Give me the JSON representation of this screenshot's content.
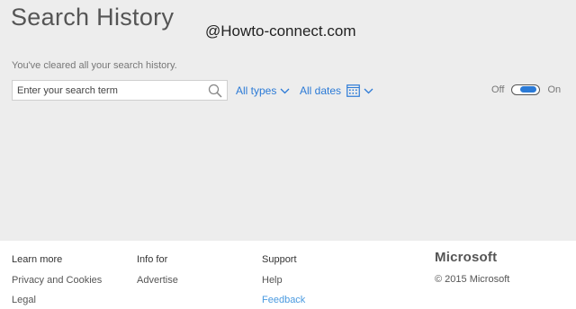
{
  "header": {
    "title": "Search History",
    "watermark": "@Howto-connect.com"
  },
  "status_message": "You've cleared all your search history.",
  "search": {
    "placeholder": "Enter your search term",
    "value": ""
  },
  "filters": {
    "types_label": "All types",
    "dates_label": "All dates"
  },
  "history_toggle": {
    "off_label": "Off",
    "on_label": "On",
    "state": "on"
  },
  "footer": {
    "col1": {
      "heading": "Learn more",
      "links": [
        "Privacy and Cookies",
        "Legal"
      ]
    },
    "col2": {
      "heading": "Info for",
      "links": [
        "Advertise"
      ]
    },
    "col3": {
      "heading": "Support",
      "links": [
        "Help",
        "Feedback"
      ]
    },
    "brand": "Microsoft",
    "copyright": "© 2015 Microsoft"
  },
  "colors": {
    "accent": "#2b7ad6",
    "main_bg": "#ededed",
    "footer_bg": "#ffffff"
  }
}
